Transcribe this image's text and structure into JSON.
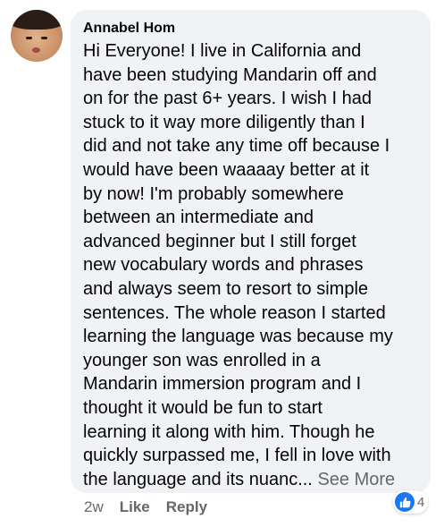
{
  "comment": {
    "author": "Annabel Hom",
    "lines": [
      "Hi Everyone!  I live in California and",
      "have been studying Mandarin off and",
      "on for the past 6+ years.  I wish I had",
      "stuck to it way more diligently than I",
      "did and not take any time off because I",
      "would have been waaaay better at it",
      "by now!  I'm probably somewhere",
      "between an intermediate and",
      "advanced beginner but I still forget",
      "new vocabulary words and phrases",
      "and always seem to resort to simple",
      "sentences. The whole reason I started",
      "learning the language was because my",
      "younger son was enrolled in a",
      "Mandarin immersion program and I",
      "thought it would be fun to start",
      "learning it along with him.  Though he",
      "quickly surpassed me, I fell in love with",
      "the language and its nuanc..."
    ],
    "see_more": "See More",
    "timestamp": "2w",
    "like_label": "Like",
    "reply_label": "Reply",
    "reaction_count": "4",
    "reaction_icon": "like-icon",
    "accent_color": "#1877f2"
  }
}
